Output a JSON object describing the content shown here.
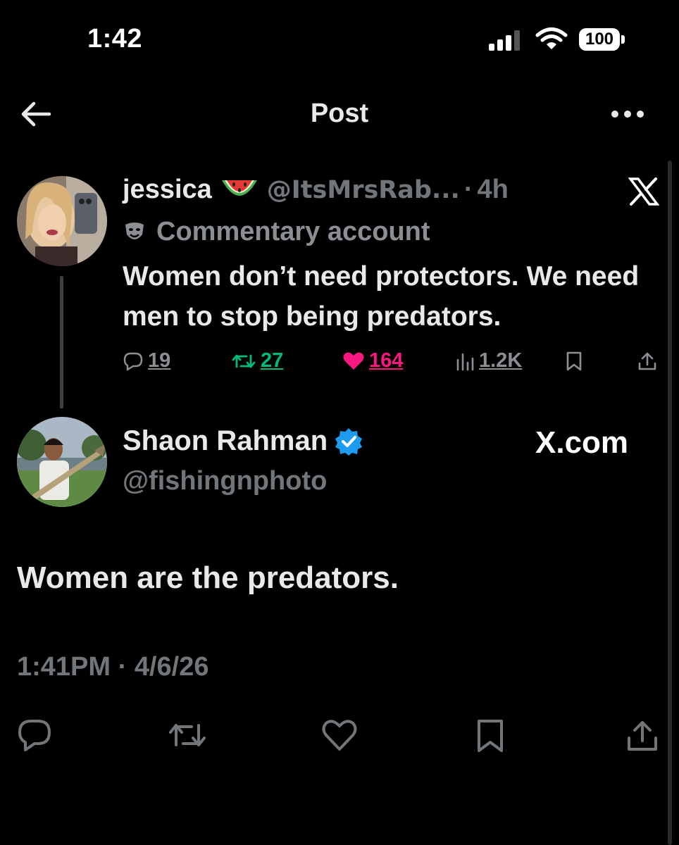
{
  "status_bar": {
    "time": "1:42",
    "battery": "100"
  },
  "nav": {
    "title": "Post"
  },
  "quoted_post": {
    "name": "jessica",
    "name_emoji": "watermelon",
    "handle": "@ItsMrsRab...",
    "separator": "·",
    "age": "4h",
    "label": "Commentary account",
    "text": "Women don’t need protectors. We need men to stop being predators.",
    "stats": {
      "replies": "19",
      "reposts": "27",
      "likes": "164",
      "views": "1.2K"
    },
    "colors": {
      "repost": "#00ba7c",
      "like": "#f91880",
      "muted": "#71767b"
    }
  },
  "post": {
    "author_name": "Shaon Rahman",
    "author_handle": "@fishingnphoto",
    "source": "X.com",
    "text": "Women are the predators.",
    "timestamp": "1:41PM · 4/6/26",
    "verified_color": "#1d9bf0"
  }
}
